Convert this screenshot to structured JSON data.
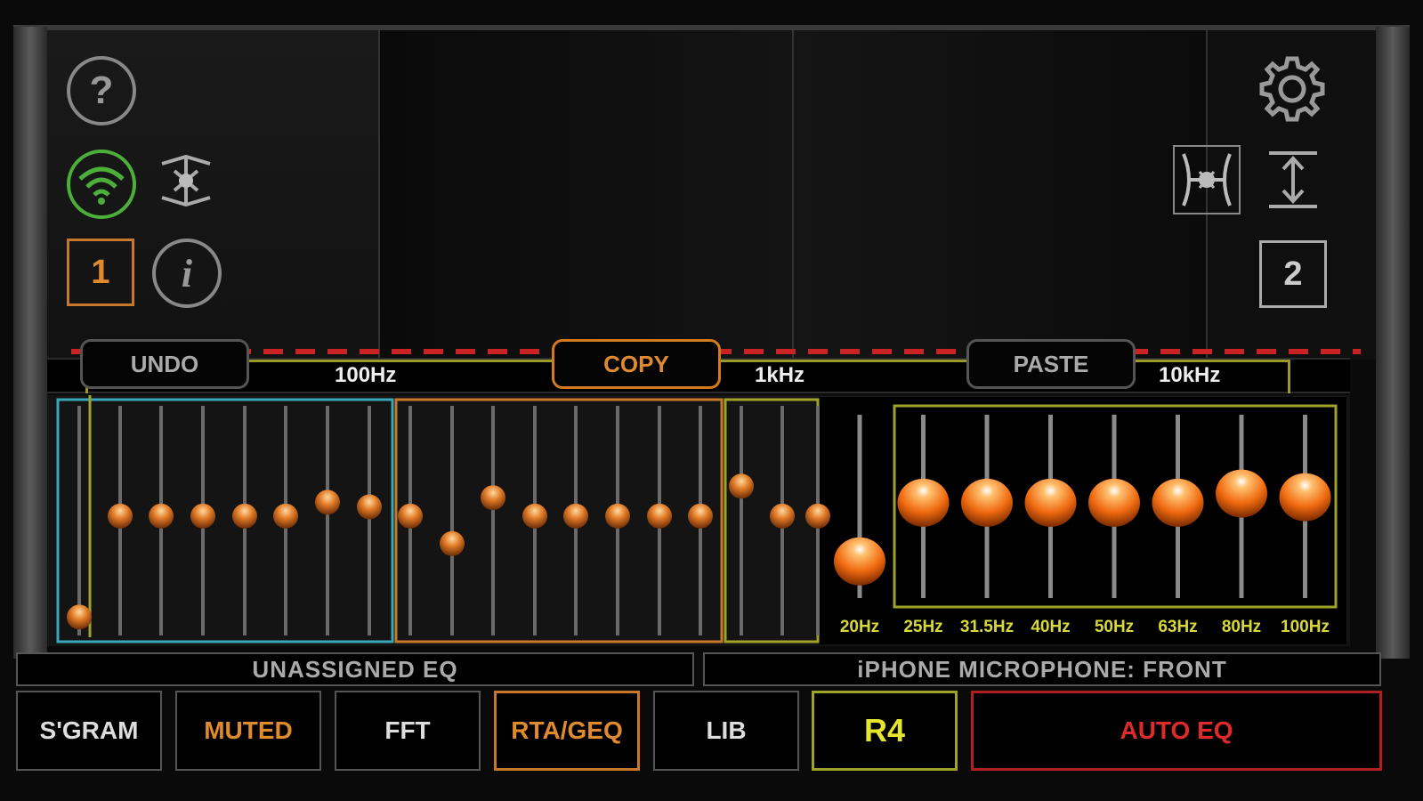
{
  "top_controls": {
    "help_glyph": "?",
    "info_glyph": "i",
    "channel_left": "1",
    "channel_right": "2",
    "icons": [
      "help-icon",
      "wifi-icon",
      "link-icon",
      "info-icon",
      "gear-icon",
      "fighter-icon",
      "link-icon"
    ]
  },
  "edit_buttons": {
    "undo": "UNDO",
    "copy": "COPY",
    "paste": "PASTE"
  },
  "frequency_markers": [
    "100Hz",
    "1kHz",
    "10kHz"
  ],
  "eq_overview": {
    "group_colors": [
      "#3aa7b8",
      "#c8782a",
      "#9fa32a"
    ],
    "slider_positions": [
      0.92,
      0.48,
      0.48,
      0.48,
      0.48,
      0.48,
      0.42,
      0.44,
      0.48,
      0.6,
      0.4,
      0.48,
      0.48,
      0.48,
      0.48,
      0.48,
      0.35,
      0.48,
      0.48
    ]
  },
  "eq_detail": {
    "bands": [
      {
        "label": "20Hz",
        "position": 0.8
      },
      {
        "label": "25Hz",
        "position": 0.48
      },
      {
        "label": "31.5Hz",
        "position": 0.48
      },
      {
        "label": "40Hz",
        "position": 0.48
      },
      {
        "label": "50Hz",
        "position": 0.48
      },
      {
        "label": "63Hz",
        "position": 0.48
      },
      {
        "label": "80Hz",
        "position": 0.43
      },
      {
        "label": "100Hz",
        "position": 0.45
      }
    ],
    "label_color": "#d8d83a",
    "knob_color": "#f07a1a"
  },
  "status_bars": {
    "left": "UNASSIGNED EQ",
    "right": "iPHONE MICROPHONE: FRONT"
  },
  "bottom_buttons": {
    "sgram": "S'GRAM",
    "muted": "MUTED",
    "fft": "FFT",
    "rta": "RTA/GEQ",
    "lib": "LIB",
    "r4": "R4",
    "autoeq": "AUTO EQ"
  }
}
